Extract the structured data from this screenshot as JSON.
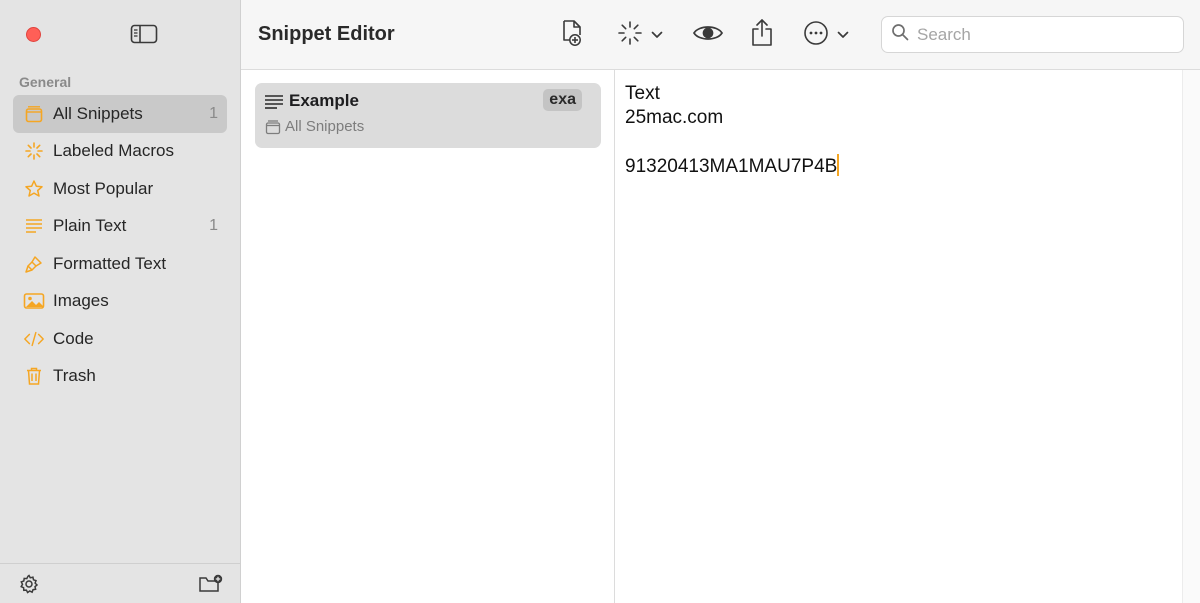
{
  "window": {
    "title": "Snippet Editor"
  },
  "sidebar": {
    "section_label": "General",
    "items": [
      {
        "label": "All Snippets",
        "count": "1",
        "icon": "tray-icon",
        "selected": true
      },
      {
        "label": "Labeled Macros",
        "count": "",
        "icon": "sparkle-icon",
        "selected": false
      },
      {
        "label": "Most Popular",
        "count": "",
        "icon": "star-icon",
        "selected": false
      },
      {
        "label": "Plain Text",
        "count": "1",
        "icon": "text-lines-icon",
        "selected": false
      },
      {
        "label": "Formatted Text",
        "count": "",
        "icon": "paintbrush-icon",
        "selected": false
      },
      {
        "label": "Images",
        "count": "",
        "icon": "photo-icon",
        "selected": false
      },
      {
        "label": "Code",
        "count": "",
        "icon": "code-icon",
        "selected": false
      },
      {
        "label": "Trash",
        "count": "",
        "icon": "trash-icon",
        "selected": false
      }
    ]
  },
  "toolbar": {
    "search_placeholder": "Search"
  },
  "snippet_list": {
    "items": [
      {
        "title": "Example",
        "abbreviation": "exa",
        "collection": "All Snippets"
      }
    ]
  },
  "editor": {
    "lines": [
      "Text",
      "25mac.com",
      "",
      "91320413MA1MAU7P4B"
    ]
  },
  "colors": {
    "accent": "#f5a623",
    "sidebar_bg": "#e4e4e4",
    "selected_bg": "#c9c9c9",
    "close_button": "#ff5f57"
  }
}
